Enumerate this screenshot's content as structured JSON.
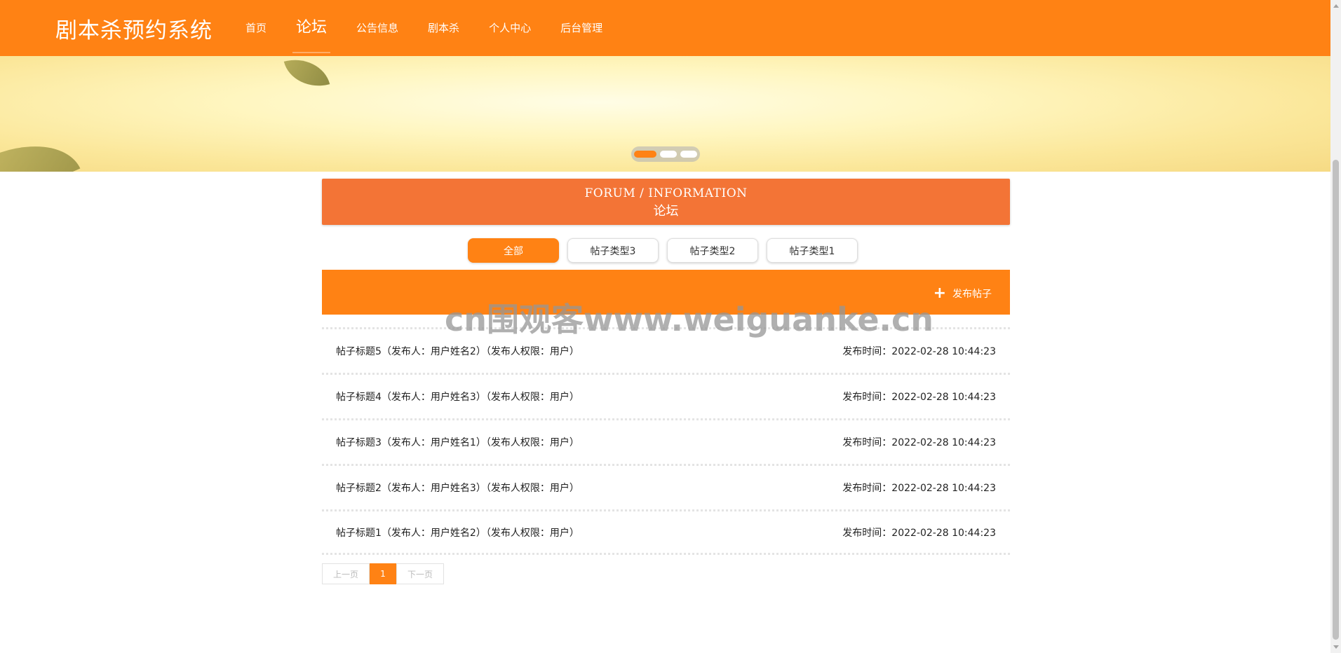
{
  "header": {
    "brand": "剧本杀预约系统",
    "nav": [
      "首页",
      "论坛",
      "公告信息",
      "剧本杀",
      "个人中心",
      "后台管理"
    ],
    "active_nav": "论坛",
    "color": "#ff8214"
  },
  "banner": {
    "slides": 3,
    "active_slide": 1
  },
  "forum_header": {
    "title_en": "FORUM / INFORMATION",
    "title_cn": "论坛",
    "color": "#f37436"
  },
  "tabs": [
    "全部",
    "帖子类型3",
    "帖子类型2",
    "帖子类型1"
  ],
  "active_tab": "全部",
  "action_bar": {
    "post_button": "发布帖子",
    "icon": "plus-icon"
  },
  "watermark": "cn围观客www.weiguanke.cn",
  "posts": [
    {
      "title": "帖子标题5（发布人：用户姓名2）（发布人权限：用户）",
      "time": "发布时间：2022-02-28 10:44:23"
    },
    {
      "title": "帖子标题4（发布人：用户姓名3）（发布人权限：用户）",
      "time": "发布时间：2022-02-28 10:44:23"
    },
    {
      "title": "帖子标题3（发布人：用户姓名1）（发布人权限：用户）",
      "time": "发布时间：2022-02-28 10:44:23"
    },
    {
      "title": "帖子标题2（发布人：用户姓名3）（发布人权限：用户）",
      "time": "发布时间：2022-02-28 10:44:23"
    },
    {
      "title": "帖子标题1（发布人：用户姓名2）（发布人权限：用户）",
      "time": "发布时间：2022-02-28 10:44:23"
    }
  ],
  "pagination": {
    "prev": "上一页",
    "current": "1",
    "next": "下一页"
  }
}
